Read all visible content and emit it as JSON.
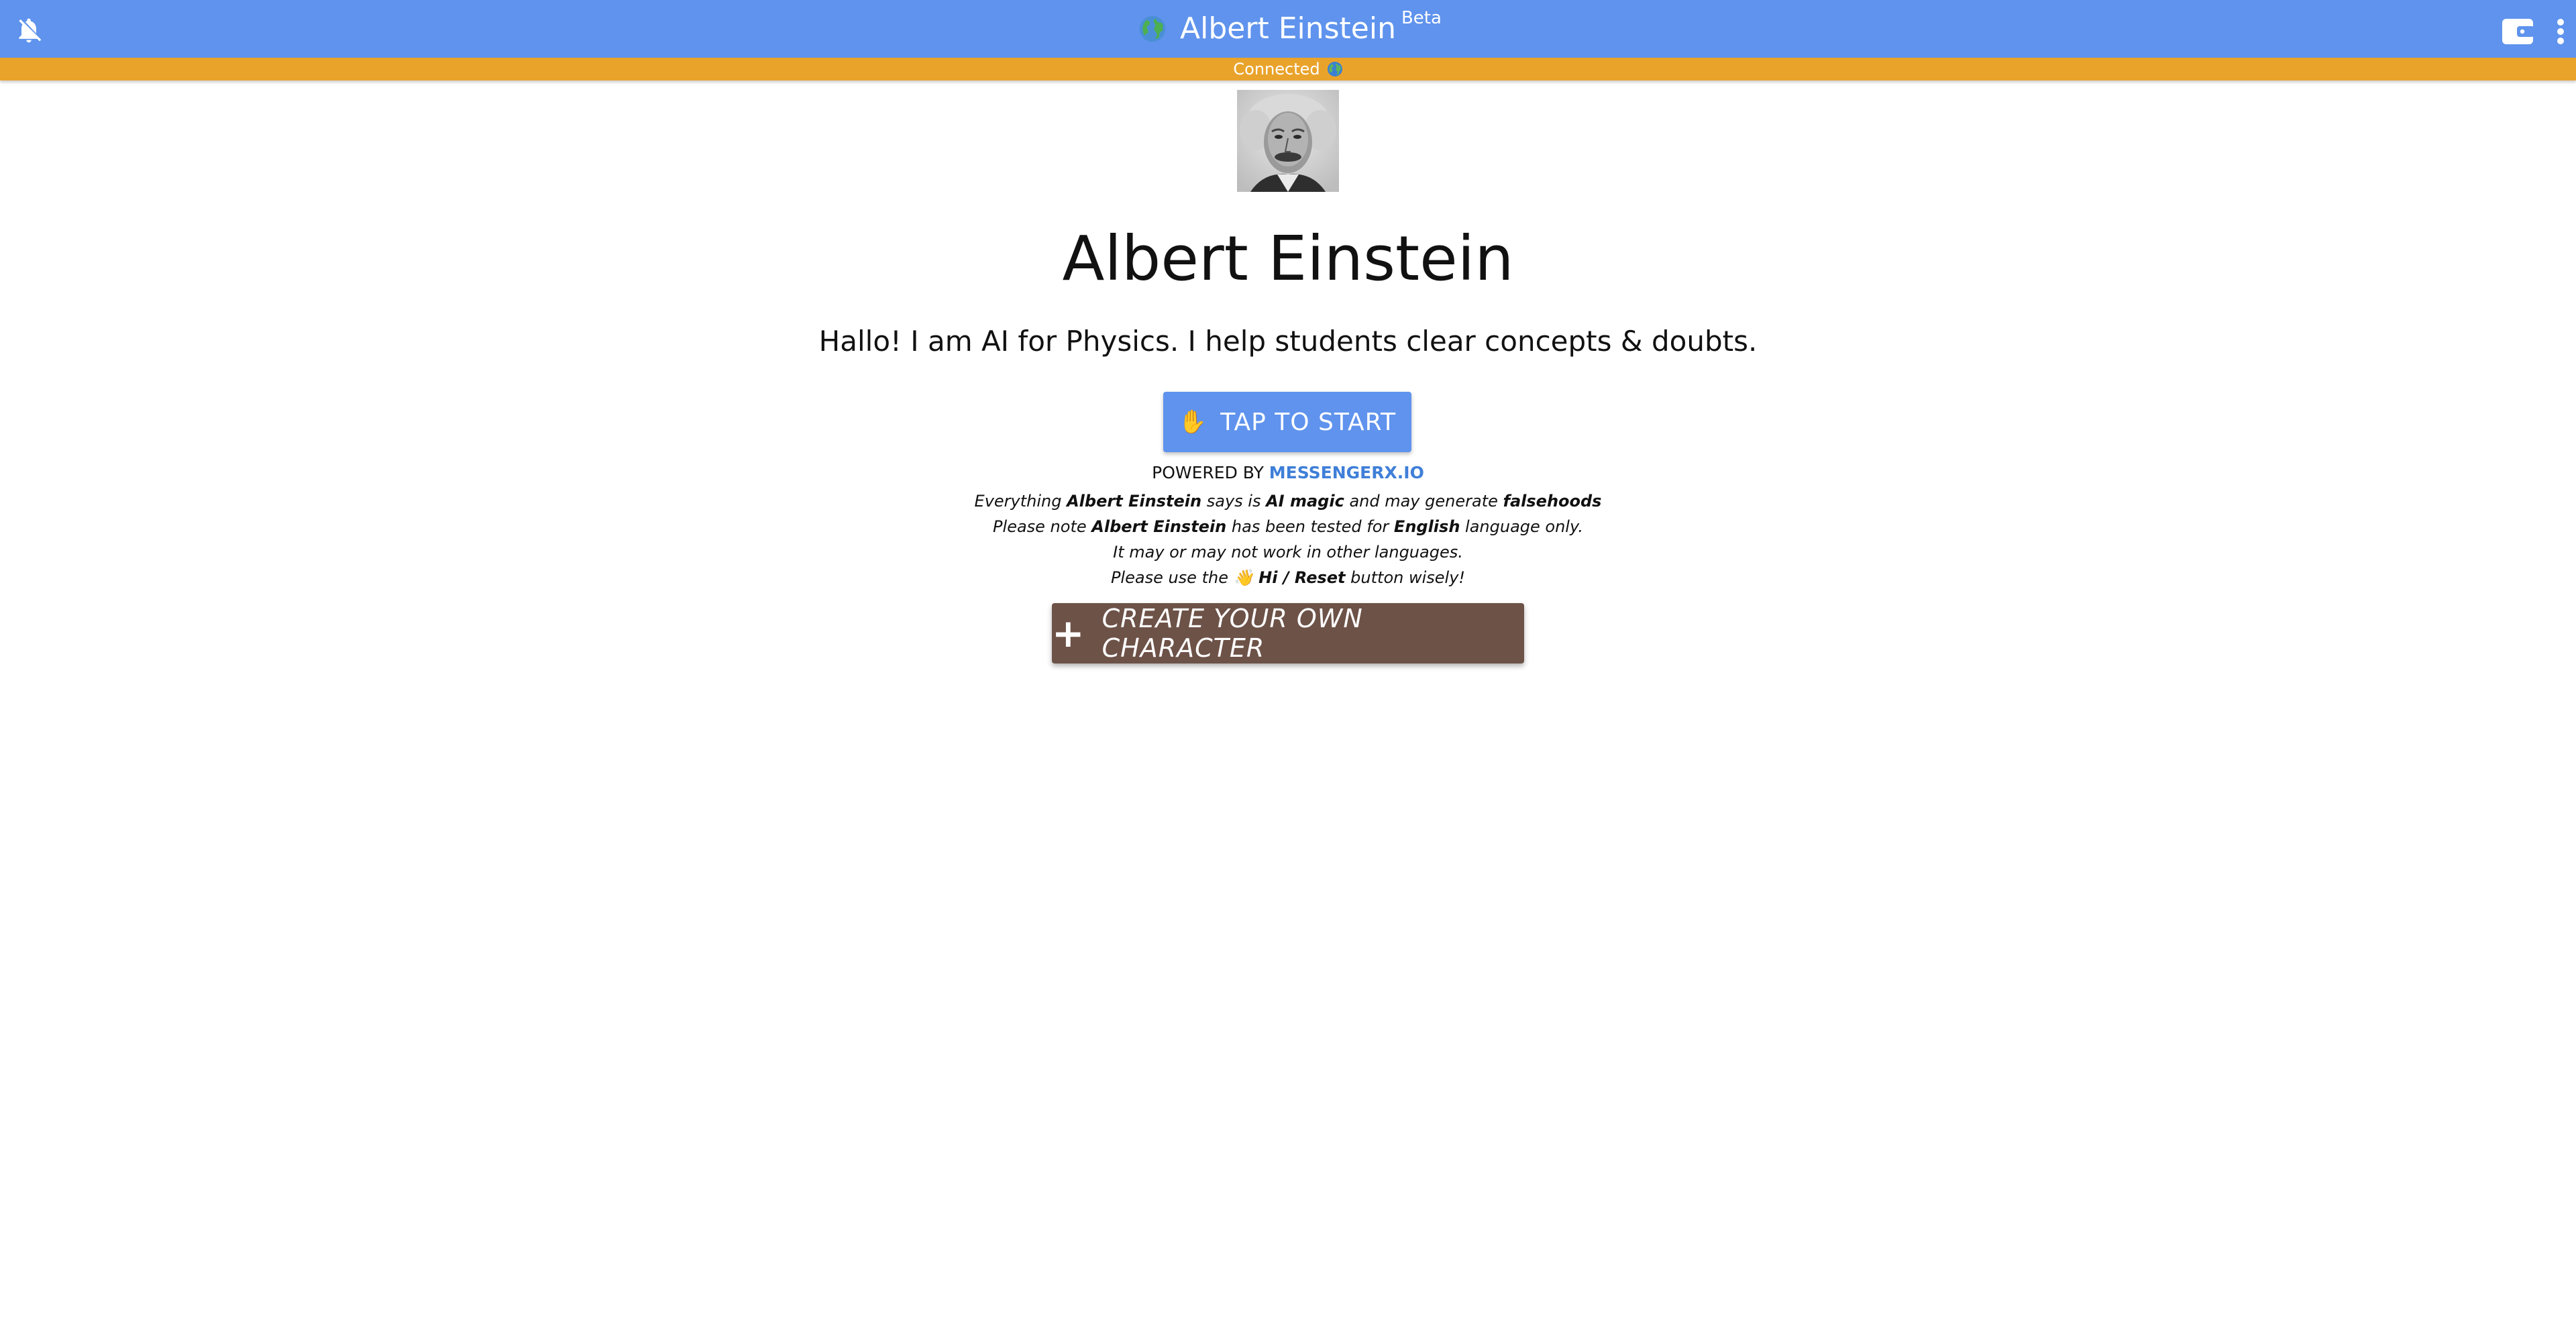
{
  "header": {
    "title": "Albert Einstein",
    "badge": "Beta",
    "icons": {
      "left": "bell-off-icon",
      "title": "globe-icon",
      "wallet": "wallet-icon",
      "menu": "more-vert-icon"
    }
  },
  "status": {
    "text": "Connected",
    "icon": "globe-icon"
  },
  "character": {
    "name": "Albert Einstein",
    "tagline": "Hallo! I am AI for Physics. I help students clear concepts & doubts."
  },
  "start_button": {
    "icon": "✋",
    "label": "TAP TO START"
  },
  "powered_by": {
    "prefix": "POWERED BY",
    "link": "MESSENGERX.IO"
  },
  "notes": {
    "line1": {
      "a": "Everything",
      "b": "Albert Einstein",
      "c": "says is",
      "d": "AI magic",
      "e": "and may generate",
      "f": "falsehoods"
    },
    "line2": {
      "a": "Please note",
      "b": "Albert Einstein",
      "c": "has been tested for",
      "d": "English",
      "e": "language only."
    },
    "line3": "It may or may not work in other languages.",
    "line4": {
      "a": "Please use the",
      "icon": "👋",
      "b": "Hi / Reset",
      "c": "button wisely!"
    }
  },
  "create_button": {
    "icon": "+",
    "label": "CREATE YOUR OWN CHARACTER"
  },
  "colors": {
    "header": "#5f93ed",
    "status": "#e9a32b",
    "start_button": "#5f93ed",
    "create_button": "#6d5248",
    "link": "#3f7fd8"
  }
}
